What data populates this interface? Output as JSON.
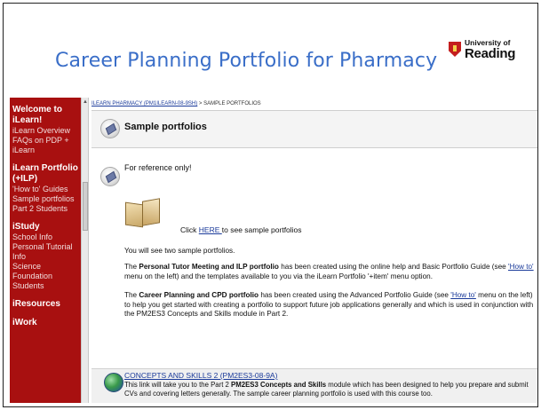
{
  "slide": {
    "title": "Career Planning Portfolio for Pharmacy",
    "logo_small": "University of",
    "logo_large": "Reading"
  },
  "sidebar": {
    "sections": [
      {
        "heading": "Welcome to iLearn!",
        "items": [
          "iLearn Overview",
          "FAQs on PDP + iLearn"
        ]
      },
      {
        "heading": "iLearn Portfolio (+ILP)",
        "items": [
          "'How to' Guides",
          "Sample portfolios",
          "Part 2 Students"
        ]
      },
      {
        "heading": "iStudy",
        "items": [
          "School Info",
          "Personal Tutorial Info",
          "Science Foundation Students"
        ]
      },
      {
        "heading": "iResources",
        "items": []
      },
      {
        "heading": "iWork",
        "items": []
      }
    ]
  },
  "breadcrumb": {
    "link": "ILEARN PHARMACY (PM1ILEARN-08-9SH)",
    "separator": " > ",
    "current": "SAMPLE PORTFOLIOS"
  },
  "main": {
    "section_title": "Sample portfolios",
    "reference_note": "For reference only!",
    "click_prefix": "Click ",
    "click_link": "HERE ",
    "click_suffix": "to see sample portfolios",
    "intro": "You will see two sample portfolios.",
    "para1_bold": "Personal Tutor Meeting and ILP portfolio",
    "para1_a": " has been created using the online help and Basic Portfolio Guide (see ",
    "para1_link": "'How to'",
    "para1_b": " menu on the left) and the templates available to you via the iLearn Portfolio '+item' menu option.",
    "para2_bold": "Career Planning and CPD portfolio",
    "para2_a": " has been created using the Advanced Portfolio Guide (see ",
    "para2_link": "'How to'",
    "para2_b": " menu on the left) to help you get started with creating a portfolio to support future job applications generally and which is used in conjunction with the PM2ES3 Concepts and Skills module in Part 2.",
    "the_word": "The "
  },
  "concepts": {
    "link": "CONCEPTS AND SKILLS 2 (PM2ES3-08-9A)",
    "desc_a": "This link will take you to the Part 2 ",
    "desc_bold": "PM2ES3 Concepts and Skills",
    "desc_b": " module which has been designed to help you prepare and submit CVs and covering letters generally. The sample career planning portfolio is used with this course too."
  }
}
